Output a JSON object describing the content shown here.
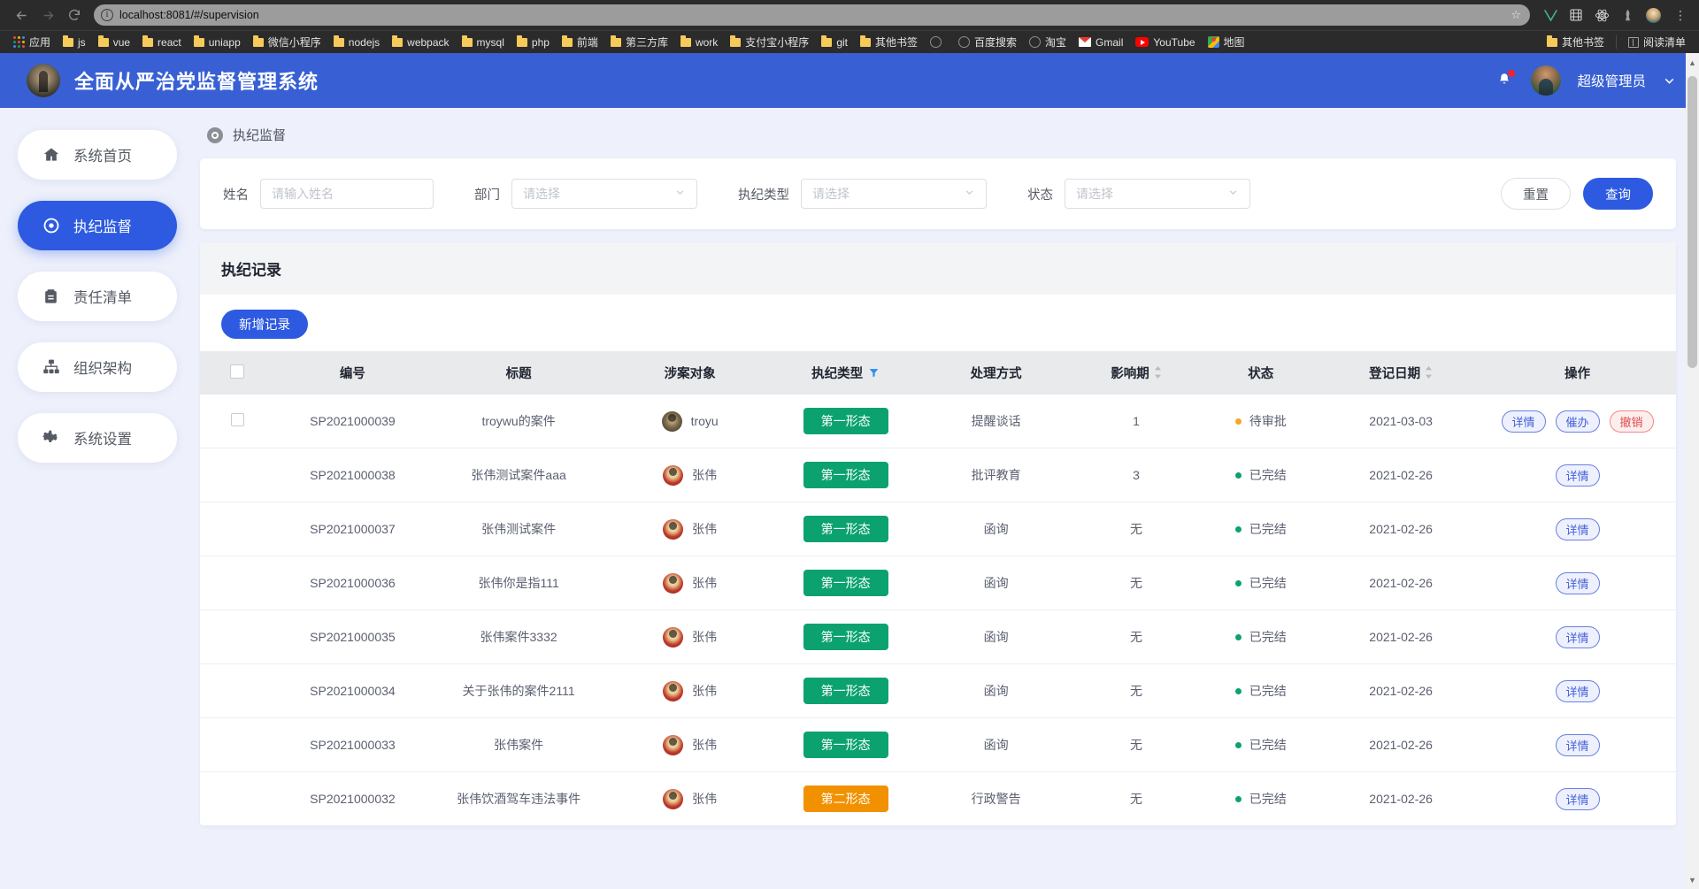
{
  "browser": {
    "back_icon": "back-arrow-icon",
    "forward_icon": "forward-arrow-icon",
    "reload_icon": "reload-icon",
    "url": "localhost:8081/#/supervision",
    "star_icon": "bookmark-star-icon",
    "menu_icon": "browser-menu-icon",
    "extensions": [
      "vue-devtools-icon",
      "extension-icon",
      "react-devtools-icon",
      "extension-gray-icon",
      "profile-avatar-icon"
    ],
    "bookmarks": [
      {
        "label": "应用",
        "icon": "apps-grid-icon"
      },
      {
        "label": "js",
        "icon": "folder-icon"
      },
      {
        "label": "vue",
        "icon": "folder-icon"
      },
      {
        "label": "react",
        "icon": "folder-icon"
      },
      {
        "label": "uniapp",
        "icon": "folder-icon"
      },
      {
        "label": "微信小程序",
        "icon": "folder-icon"
      },
      {
        "label": "nodejs",
        "icon": "folder-icon"
      },
      {
        "label": "webpack",
        "icon": "folder-icon"
      },
      {
        "label": "mysql",
        "icon": "folder-icon"
      },
      {
        "label": "php",
        "icon": "folder-icon"
      },
      {
        "label": "前端",
        "icon": "folder-icon"
      },
      {
        "label": "第三方库",
        "icon": "folder-icon"
      },
      {
        "label": "work",
        "icon": "folder-icon"
      },
      {
        "label": "支付宝小程序",
        "icon": "folder-icon"
      },
      {
        "label": "git",
        "icon": "folder-icon"
      },
      {
        "label": "其他书签",
        "icon": "folder-icon"
      },
      {
        "label": "",
        "icon": "globe-icon"
      },
      {
        "label": "百度搜索",
        "icon": "globe-icon"
      },
      {
        "label": "淘宝",
        "icon": "globe-icon"
      },
      {
        "label": "Gmail",
        "icon": "gmail-icon"
      },
      {
        "label": "YouTube",
        "icon": "youtube-icon"
      },
      {
        "label": "地图",
        "icon": "maps-icon"
      }
    ],
    "bookmarks_right": [
      {
        "label": "其他书签",
        "icon": "folder-icon"
      },
      {
        "label": "阅读清单",
        "icon": "reading-list-icon"
      }
    ]
  },
  "header": {
    "title": "全面从严治党监督管理系统",
    "logo_icon": "app-logo-avatar",
    "bell_icon": "notification-bell-icon",
    "avatar_icon": "user-avatar",
    "user_name": "超级管理员",
    "caret_icon": "chevron-down-icon"
  },
  "sidebar": {
    "items": [
      {
        "label": "系统首页",
        "icon": "home-icon",
        "active": false
      },
      {
        "label": "执纪监督",
        "icon": "target-icon",
        "active": true
      },
      {
        "label": "责任清单",
        "icon": "clipboard-icon",
        "active": false
      },
      {
        "label": "组织架构",
        "icon": "org-chart-icon",
        "active": false
      },
      {
        "label": "系统设置",
        "icon": "gear-icon",
        "active": false
      }
    ]
  },
  "breadcrumb": {
    "icon": "target-icon",
    "label": "执纪监督"
  },
  "filters": {
    "name": {
      "label": "姓名",
      "placeholder": "请输入姓名",
      "value": ""
    },
    "department": {
      "label": "部门",
      "placeholder": "请选择",
      "value": ""
    },
    "type": {
      "label": "执纪类型",
      "placeholder": "请选择",
      "value": ""
    },
    "status": {
      "label": "状态",
      "placeholder": "请选择",
      "value": ""
    },
    "reset_label": "重置",
    "search_label": "查询"
  },
  "table": {
    "section_title": "执纪记录",
    "add_label": "新增记录",
    "columns": [
      {
        "key": "checkbox",
        "label": ""
      },
      {
        "key": "code",
        "label": "编号"
      },
      {
        "key": "title",
        "label": "标题"
      },
      {
        "key": "person",
        "label": "涉案对象"
      },
      {
        "key": "type",
        "label": "执纪类型",
        "filter_icon": "funnel-filter-icon"
      },
      {
        "key": "handling",
        "label": "处理方式"
      },
      {
        "key": "period",
        "label": "影响期",
        "sort_icon": "sort-arrows-icon"
      },
      {
        "key": "status",
        "label": "状态"
      },
      {
        "key": "date",
        "label": "登记日期",
        "sort_icon": "sort-arrows-icon"
      },
      {
        "key": "ops",
        "label": "操作"
      }
    ],
    "rows": [
      {
        "code": "SP2021000039",
        "title": "troywu的案件",
        "person": "troyu",
        "avatar": "troyu",
        "type": "第一形态",
        "type_color": "green",
        "handling": "提醒谈话",
        "period": "1",
        "status": "待审批",
        "status_color": "#f5a623",
        "date": "2021-03-03",
        "ops": [
          {
            "label": "详情",
            "style": "primary"
          },
          {
            "label": "催办",
            "style": "primary"
          },
          {
            "label": "撤销",
            "style": "danger"
          }
        ]
      },
      {
        "code": "SP2021000038",
        "title": "张伟测试案件aaa",
        "person": "张伟",
        "avatar": "zw",
        "type": "第一形态",
        "type_color": "green",
        "handling": "批评教育",
        "period": "3",
        "status": "已完结",
        "status_color": "#0ba26f",
        "date": "2021-02-26",
        "ops": [
          {
            "label": "详情",
            "style": "primary"
          }
        ]
      },
      {
        "code": "SP2021000037",
        "title": "张伟测试案件",
        "person": "张伟",
        "avatar": "zw",
        "type": "第一形态",
        "type_color": "green",
        "handling": "函询",
        "period": "无",
        "status": "已完结",
        "status_color": "#0ba26f",
        "date": "2021-02-26",
        "ops": [
          {
            "label": "详情",
            "style": "primary"
          }
        ]
      },
      {
        "code": "SP2021000036",
        "title": "张伟你是指111",
        "person": "张伟",
        "avatar": "zw",
        "type": "第一形态",
        "type_color": "green",
        "handling": "函询",
        "period": "无",
        "status": "已完结",
        "status_color": "#0ba26f",
        "date": "2021-02-26",
        "ops": [
          {
            "label": "详情",
            "style": "primary"
          }
        ]
      },
      {
        "code": "SP2021000035",
        "title": "张伟案件3332",
        "person": "张伟",
        "avatar": "zw",
        "type": "第一形态",
        "type_color": "green",
        "handling": "函询",
        "period": "无",
        "status": "已完结",
        "status_color": "#0ba26f",
        "date": "2021-02-26",
        "ops": [
          {
            "label": "详情",
            "style": "primary"
          }
        ]
      },
      {
        "code": "SP2021000034",
        "title": "关于张伟的案件2111",
        "person": "张伟",
        "avatar": "zw",
        "type": "第一形态",
        "type_color": "green",
        "handling": "函询",
        "period": "无",
        "status": "已完结",
        "status_color": "#0ba26f",
        "date": "2021-02-26",
        "ops": [
          {
            "label": "详情",
            "style": "primary"
          }
        ]
      },
      {
        "code": "SP2021000033",
        "title": "张伟案件",
        "person": "张伟",
        "avatar": "zw",
        "type": "第一形态",
        "type_color": "green",
        "handling": "函询",
        "period": "无",
        "status": "已完结",
        "status_color": "#0ba26f",
        "date": "2021-02-26",
        "ops": [
          {
            "label": "详情",
            "style": "primary"
          }
        ]
      },
      {
        "code": "SP2021000032",
        "title": "张伟饮酒驾车违法事件",
        "person": "张伟",
        "avatar": "zw",
        "type": "第二形态",
        "type_color": "orange",
        "handling": "行政警告",
        "period": "无",
        "status": "已完结",
        "status_color": "#0ba26f",
        "date": "2021-02-26",
        "ops": [
          {
            "label": "详情",
            "style": "primary"
          }
        ]
      }
    ]
  },
  "colors": {
    "brand": "#3860d4",
    "primary": "#2d5ae0",
    "tag_green": "#0ba26f",
    "tag_orange": "#f29100",
    "danger": "#e04c4c",
    "page_bg": "#eef1fb"
  }
}
